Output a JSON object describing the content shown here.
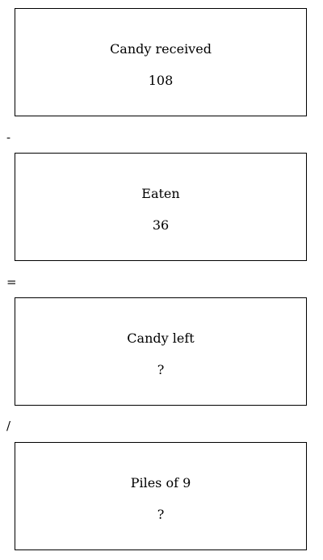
{
  "boxes": [
    {
      "label": "Candy received",
      "value": "108"
    },
    {
      "label": "Eaten",
      "value": "36"
    },
    {
      "label": "Candy left",
      "value": "?"
    },
    {
      "label": "Piles of 9",
      "value": "?"
    }
  ],
  "operators": [
    "-",
    "=",
    "/"
  ]
}
